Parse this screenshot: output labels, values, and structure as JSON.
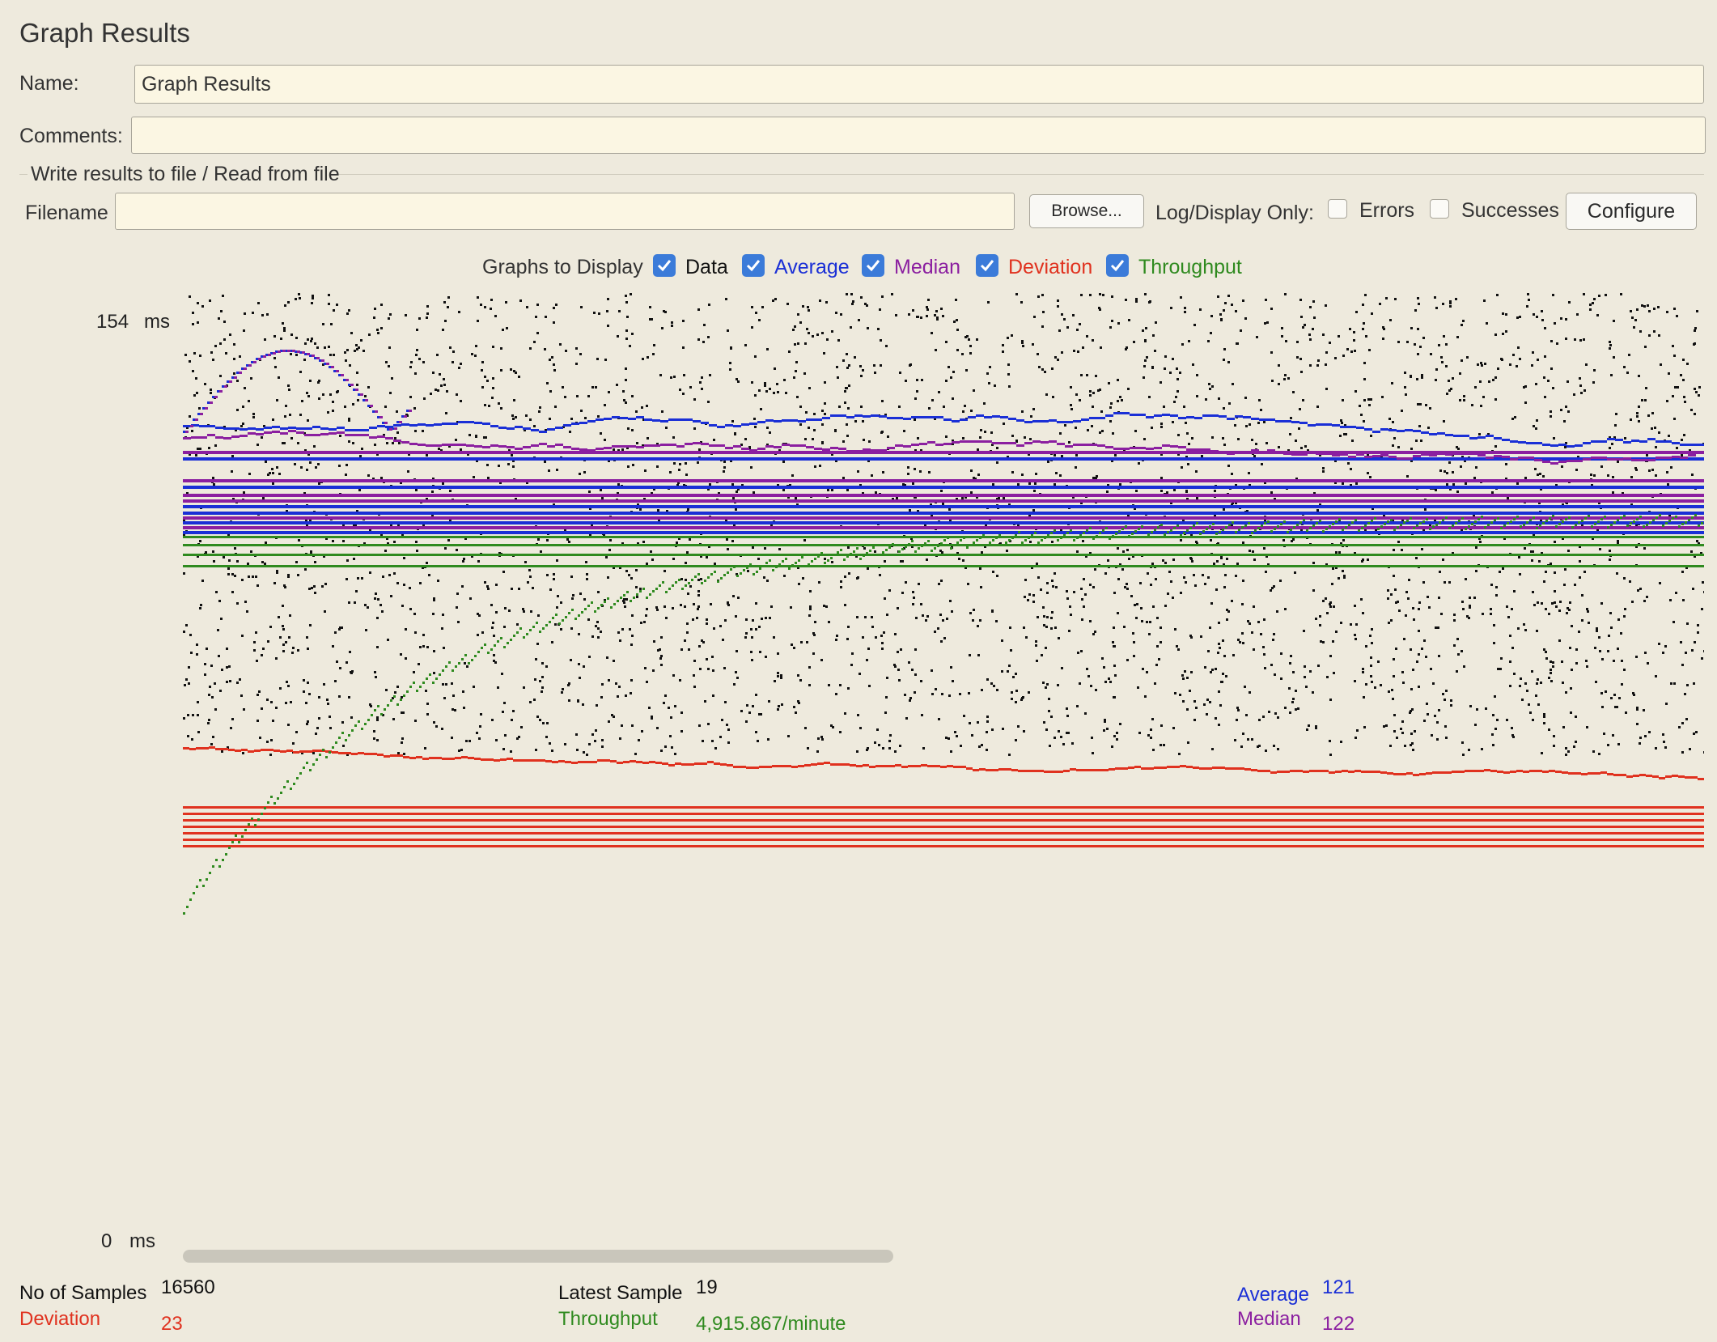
{
  "panel": {
    "title": "Graph Results"
  },
  "name": {
    "label": "Name:",
    "value": "Graph Results"
  },
  "comments": {
    "label": "Comments:",
    "value": ""
  },
  "file": {
    "group_title": "Write results to file / Read from file",
    "filename_label": "Filename",
    "filename_value": "",
    "browse_label": "Browse...",
    "log_display_label": "Log/Display Only:",
    "errors_label": "Errors",
    "errors_checked": false,
    "successes_label": "Successes",
    "successes_checked": false,
    "configure_label": "Configure"
  },
  "graphs": {
    "label": "Graphs to Display",
    "items": [
      {
        "label": "Data",
        "checked": true,
        "color": "#111111"
      },
      {
        "label": "Average",
        "checked": true,
        "color": "#1a2fd6"
      },
      {
        "label": "Median",
        "checked": true,
        "color": "#8b1fa0"
      },
      {
        "label": "Deviation",
        "checked": true,
        "color": "#e0321f"
      },
      {
        "label": "Throughput",
        "checked": true,
        "color": "#2f8a1f"
      }
    ]
  },
  "axis": {
    "top": "154",
    "bottom": "0",
    "unit": "ms"
  },
  "chart_data": {
    "type": "scatter",
    "ylim": [
      0,
      154
    ],
    "series": [
      {
        "name": "Data",
        "color": "#111111"
      },
      {
        "name": "Average",
        "color": "#1a2fd6"
      },
      {
        "name": "Median",
        "color": "#8b1fa0"
      },
      {
        "name": "Deviation",
        "color": "#e0321f"
      },
      {
        "name": "Throughput",
        "color": "#2f8a1f"
      }
    ]
  },
  "stats": {
    "samples_label": "No of Samples",
    "samples_value": "16560",
    "deviation_label": "Deviation",
    "deviation_value": "23",
    "latest_label": "Latest Sample",
    "latest_value": "19",
    "throughput_label": "Throughput",
    "throughput_value": "4,915.867/minute",
    "average_label": "Average",
    "average_value": "121",
    "median_label": "Median",
    "median_value": "122"
  }
}
